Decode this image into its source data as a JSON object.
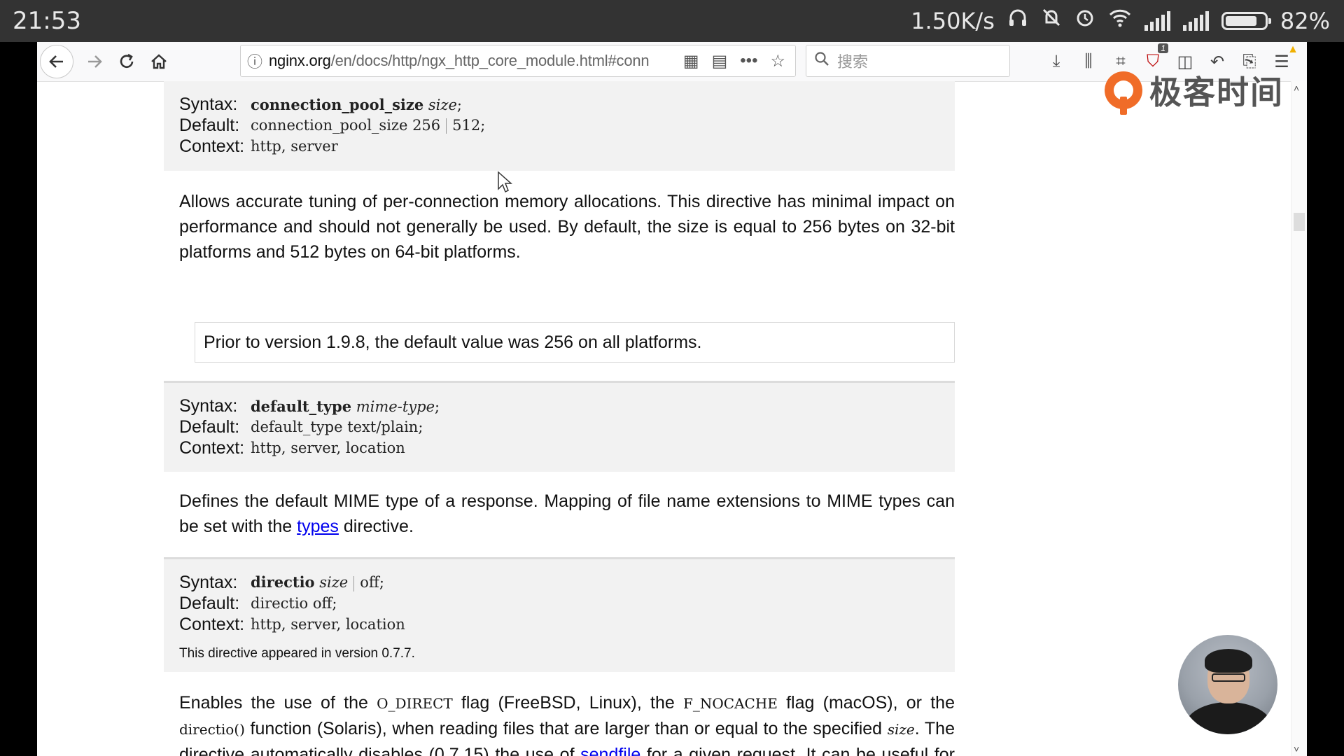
{
  "status_bar": {
    "time": "21:53",
    "net_speed": "1.50K/s",
    "battery_percent": "82%",
    "battery_level": 0.82
  },
  "browser": {
    "url_host": "nginx.org",
    "url_path": "/en/docs/http/ngx_http_core_module.html#conn",
    "search_placeholder": "搜索",
    "ublock_badge": "1"
  },
  "watermark": {
    "text": "极客时间"
  },
  "directives": [
    {
      "syntax_name": "connection_pool_size",
      "syntax_arg": "size",
      "syntax_end": ";",
      "default_a": "connection_pool_size 256",
      "default_b": "512;",
      "context": "http, server"
    },
    {
      "syntax_name": "default_type",
      "syntax_arg": "mime-type",
      "syntax_end": ";",
      "default": "default_type text/plain;",
      "context": "http, server, location"
    },
    {
      "syntax_name": "directio",
      "syntax_arg": "size",
      "syntax_alt": "off;",
      "default": "directio off;",
      "context": "http, server, location",
      "appeared": "This directive appeared in version 0.7.7."
    }
  ],
  "labels": {
    "syntax": "Syntax:",
    "default": "Default:",
    "context": "Context:"
  },
  "paragraphs": {
    "p1": "Allows accurate tuning of per-connection memory allocations. This directive has minimal impact on performance and should not generally be used. By default, the size is equal to 256 bytes on 32-bit platforms and 512 bytes on 64-bit platforms.",
    "note": "Prior to version 1.9.8, the default value was 256 on all platforms.",
    "p2_a": "Defines the default MIME type of a response. Mapping of file name extensions to MIME types can be set with the ",
    "p2_link": "types",
    "p2_b": " directive.",
    "p3_a": "Enables the use of the ",
    "p3_code1": "O_DIRECT",
    "p3_b": " flag (FreeBSD, Linux), the ",
    "p3_code2": "F_NOCACHE",
    "p3_c": " flag (macOS), or the ",
    "p3_code3": "directio()",
    "p3_d": " function (Solaris), when reading files that are larger than or equal to the specified ",
    "p3_code4": "size",
    "p3_e": ". The directive automatically disables (0.7.15) the use of ",
    "p3_link": "sendfile",
    "p3_f": " for a given request. It can be useful for serving large files:"
  }
}
